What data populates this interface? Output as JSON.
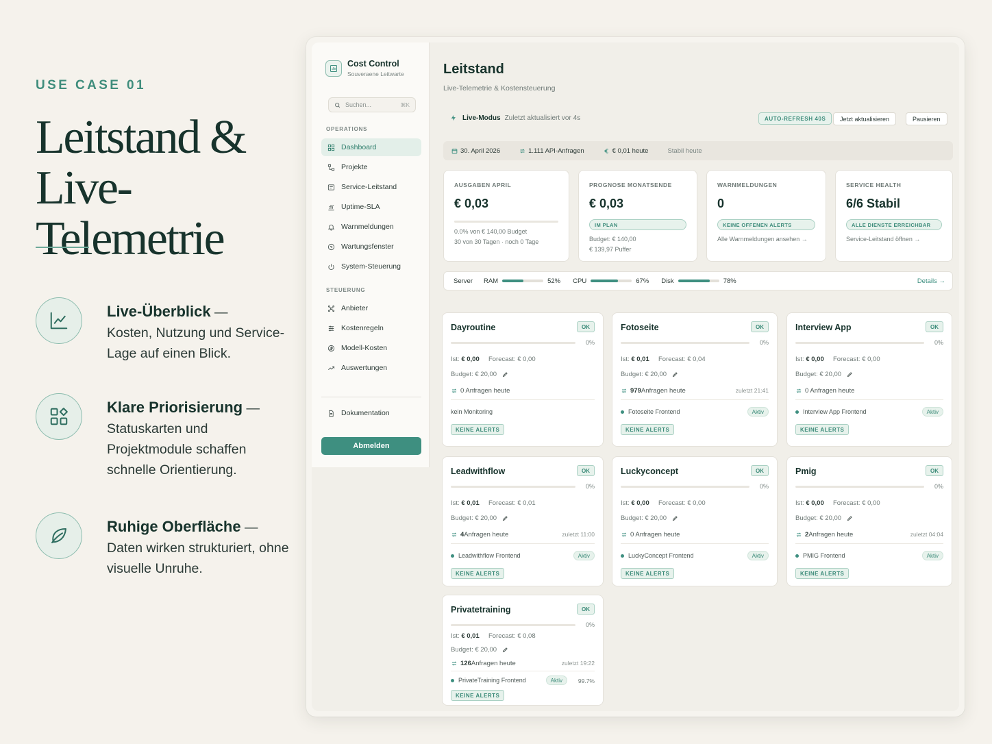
{
  "marketing": {
    "eyebrow": "USE CASE 01",
    "headline_line1": "Leitstand &",
    "headline_line2": "Live-Telemetrie",
    "features": [
      {
        "title": "Live-Überblick",
        "text": "Kosten, Nutzung und Service-Lage auf einen Blick.",
        "icon": "chart-line-icon"
      },
      {
        "title": "Klare Priorisierung",
        "text": "Statuskarten und Projektmodule schaffen schnelle Orientierung.",
        "icon": "widgets-icon"
      },
      {
        "title": "Ruhige Oberfläche",
        "text": "Daten wirken strukturiert, ohne visuelle Unruhe.",
        "icon": "leaf-icon"
      }
    ],
    "dash": " —"
  },
  "sidebar": {
    "brand_name": "Cost Control",
    "brand_sub": "Souveraene Leitwarte",
    "search_placeholder": "Suchen...",
    "search_shortcut": "⌘K",
    "section_operations": "OPERATIONS",
    "section_steuerung": "STEUERUNG",
    "operations": [
      "Dashboard",
      "Projekte",
      "Service-Leitstand",
      "Uptime-SLA",
      "Warnmeldungen",
      "Wartungsfenster",
      "System-Steuerung"
    ],
    "steuerung": [
      "Anbieter",
      "Kostenregeln",
      "Modell-Kosten",
      "Auswertungen"
    ],
    "documentation": "Dokumentation",
    "logout": "Abmelden"
  },
  "header": {
    "title": "Leitstand",
    "subtitle": "Live-Telemetrie & Kostensteuerung",
    "live_label": "Live-Modus",
    "live_updated": "Zuletzt aktualisiert vor 4s",
    "auto_refresh": "AUTO-REFRESH 40S",
    "refresh_now": "Jetzt aktualisieren",
    "pause": "Pausieren"
  },
  "status_strip": {
    "date": "30. April 2026",
    "api_requests": "1.111 API-Anfragen",
    "today_cost": "€ 0,01 heute",
    "stable": "Stabil heute"
  },
  "kpis": {
    "spend": {
      "label": "AUSGABEN APRIL",
      "value": "€ 0,03",
      "line1": "0.0% von € 140,00 Budget",
      "line2": "30 von 30 Tagen · noch 0 Tage"
    },
    "forecast": {
      "label": "PROGNOSE MONATSENDE",
      "value": "€ 0,03",
      "pill": "IM PLAN",
      "line1": "Budget: € 140,00",
      "line2": "€ 139,97 Puffer"
    },
    "alerts": {
      "label": "WARNMELDUNGEN",
      "value": "0",
      "pill": "KEINE OFFENEN ALERTS",
      "link": "Alle Warnmeldungen ansehen →"
    },
    "health": {
      "label": "SERVICE HEALTH",
      "value": "6/6 Stabil",
      "pill": "ALLE DIENSTE ERREICHBAR",
      "link": "Service-Leitstand öffnen →"
    }
  },
  "server": {
    "label": "Server",
    "ram_label": "RAM",
    "ram_pct": "52%",
    "ram_value": 52,
    "cpu_label": "CPU",
    "cpu_pct": "67%",
    "cpu_value": 67,
    "disk_label": "Disk",
    "disk_pct": "78%",
    "disk_value": 78,
    "details": "Details →"
  },
  "projects": [
    {
      "name": "Dayroutine",
      "ok": "OK",
      "pct": "0%",
      "ist_label": "Ist:",
      "ist": "€ 0,00",
      "fc_label": "Forecast:",
      "fc": "€ 0,00",
      "budget": "Budget: € 20,00",
      "req_count": "",
      "req_text": "0 Anfragen heute",
      "last": "",
      "monitor": "kein Monitoring",
      "monitor_active": false,
      "aktiv": "",
      "uptime": "",
      "alerts": "KEINE ALERTS"
    },
    {
      "name": "Fotoseite",
      "ok": "OK",
      "pct": "0%",
      "ist_label": "Ist:",
      "ist": "€ 0,01",
      "fc_label": "Forecast:",
      "fc": "€ 0,04",
      "budget": "Budget: € 20,00",
      "req_count": "979",
      "req_text": " Anfragen heute",
      "last": "zuletzt 21:41",
      "monitor": "Fotoseite Frontend",
      "monitor_active": true,
      "aktiv": "Aktiv",
      "uptime": "",
      "alerts": "KEINE ALERTS"
    },
    {
      "name": "Interview App",
      "ok": "OK",
      "pct": "0%",
      "ist_label": "Ist:",
      "ist": "€ 0,00",
      "fc_label": "Forecast:",
      "fc": "€ 0,00",
      "budget": "Budget: € 20,00",
      "req_count": "",
      "req_text": "0 Anfragen heute",
      "last": "",
      "monitor": "Interview App Frontend",
      "monitor_active": true,
      "aktiv": "Aktiv",
      "uptime": "",
      "alerts": "KEINE ALERTS"
    },
    {
      "name": "Leadwithflow",
      "ok": "OK",
      "pct": "0%",
      "ist_label": "Ist:",
      "ist": "€ 0,01",
      "fc_label": "Forecast:",
      "fc": "€ 0,01",
      "budget": "Budget: € 20,00",
      "req_count": "4",
      "req_text": " Anfragen heute",
      "last": "zuletzt 11:00",
      "monitor": "Leadwithflow Frontend",
      "monitor_active": true,
      "aktiv": "Aktiv",
      "uptime": "",
      "alerts": "KEINE ALERTS"
    },
    {
      "name": "Luckyconcept",
      "ok": "OK",
      "pct": "0%",
      "ist_label": "Ist:",
      "ist": "€ 0,00",
      "fc_label": "Forecast:",
      "fc": "€ 0,00",
      "budget": "Budget: € 20,00",
      "req_count": "",
      "req_text": "0 Anfragen heute",
      "last": "",
      "monitor": "LuckyConcept Frontend",
      "monitor_active": true,
      "aktiv": "Aktiv",
      "uptime": "",
      "alerts": "KEINE ALERTS"
    },
    {
      "name": "Pmig",
      "ok": "OK",
      "pct": "0%",
      "ist_label": "Ist:",
      "ist": "€ 0,00",
      "fc_label": "Forecast:",
      "fc": "€ 0,00",
      "budget": "Budget: € 20,00",
      "req_count": "2",
      "req_text": " Anfragen heute",
      "last": "zuletzt 04:04",
      "monitor": "PMIG Frontend",
      "monitor_active": true,
      "aktiv": "Aktiv",
      "uptime": "",
      "alerts": "KEINE ALERTS"
    },
    {
      "name": "Privatetraining",
      "ok": "OK",
      "pct": "0%",
      "ist_label": "Ist:",
      "ist": "€ 0,01",
      "fc_label": "Forecast:",
      "fc": "€ 0,08",
      "budget": "Budget: € 20,00",
      "req_count": "126",
      "req_text": " Anfragen heute",
      "last": "zuletzt 19:22",
      "monitor": "PrivateTraining Frontend",
      "monitor_active": true,
      "aktiv": "Aktiv",
      "uptime": "99.7%",
      "alerts": "KEINE ALERTS"
    }
  ],
  "colors": {
    "accent": "#3e8f80",
    "background": "#f5f2ec",
    "headline": "#17332c"
  }
}
